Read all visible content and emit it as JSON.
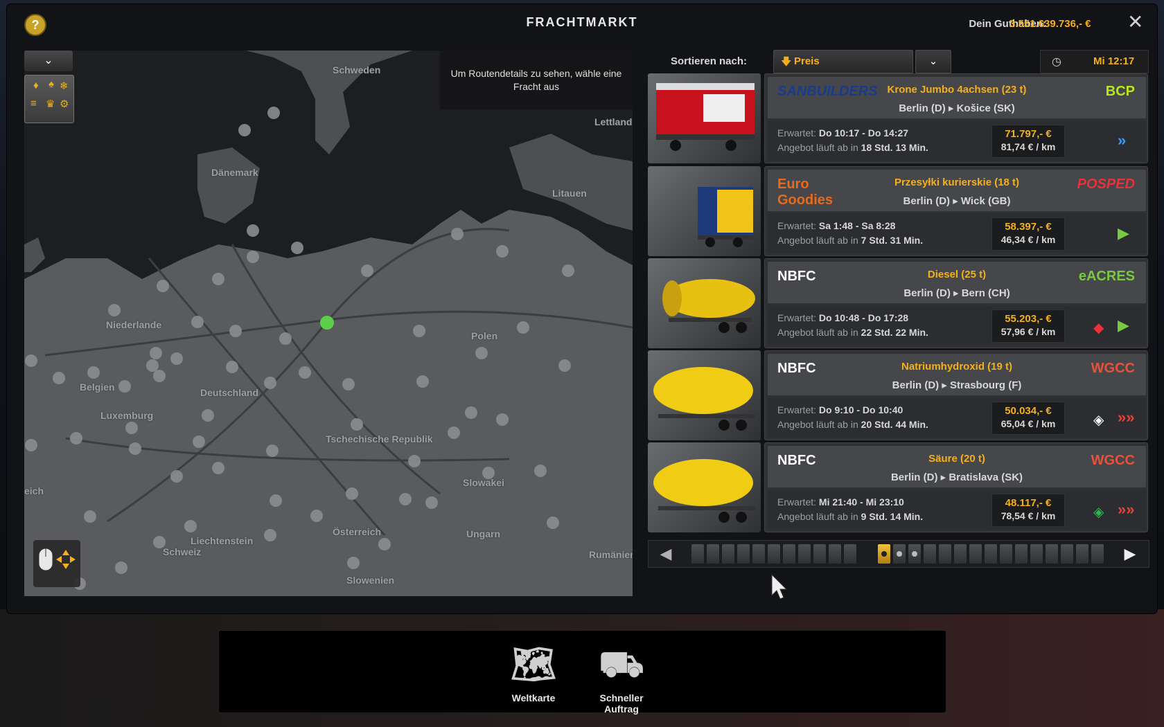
{
  "header": {
    "title": "FRACHTMARKT",
    "help_label": "?",
    "balance_label": "Dein Guthaben:",
    "balance_value": "3.551.639.736,- €",
    "close_label": "✕"
  },
  "map": {
    "hint": "Um Routendetails zu sehen, wähle eine Fracht aus",
    "labels": [
      "Schweden",
      "Dänemark",
      "Lettland",
      "Litauen",
      "Niederlande",
      "Polen",
      "Belgien",
      "Deutschland",
      "Luxemburg",
      "Tschechische Republik",
      "Slowakei",
      "eich",
      "Österreich",
      "Ungarn",
      "Liechtenstein",
      "Schweiz",
      "Rumänien",
      "Slowenien"
    ]
  },
  "toolbar": {
    "sort_label": "Sortieren nach:",
    "sort_value": "Preis",
    "time": "Mi 12:17"
  },
  "cargos": [
    {
      "company": "SANBUILDERS",
      "target_company": "BCP",
      "name": "Krone Jumbo 4achsen (23 t)",
      "from": "Berlin (D)",
      "to": "Košice (SK)",
      "expected_label": "Erwartet:",
      "expected": "Do 10:17 - Do 14:27",
      "offer_label": "Angebot läuft ab in",
      "offer": "18 Std. 13 Min.",
      "price": "71.797,- €",
      "per_km": "81,74 € / km",
      "hazard": "",
      "urgency": "»",
      "urgency_color": "#3b9cff"
    },
    {
      "company": "Euro Goodies",
      "target_company": "POSPED",
      "name": "Przesyłki kurierskie (18 t)",
      "from": "Berlin (D)",
      "to": "Wick (GB)",
      "expected_label": "Erwartet:",
      "expected": "Sa 1:48 - Sa 8:28",
      "offer_label": "Angebot läuft ab in",
      "offer": "7 Std. 31 Min.",
      "price": "58.397,- €",
      "per_km": "46,34 € / km",
      "hazard": "",
      "urgency": "▶",
      "urgency_color": "#7ac943"
    },
    {
      "company": "NBFC",
      "target_company": "eACRES",
      "name": "Diesel (25 t)",
      "from": "Berlin (D)",
      "to": "Bern (CH)",
      "expected_label": "Erwartet:",
      "expected": "Do 10:48 - Do 17:28",
      "offer_label": "Angebot läuft ab in",
      "offer": "22 Std. 22 Min.",
      "price": "55.203,- €",
      "per_km": "57,96 € / km",
      "hazard": "◆",
      "urgency": "▶",
      "urgency_color": "#7ac943"
    },
    {
      "company": "NBFC",
      "target_company": "WGCC",
      "name": "Natriumhydroxid (19 t)",
      "from": "Berlin (D)",
      "to": "Strasbourg (F)",
      "expected_label": "Erwartet:",
      "expected": "Do 9:10 - Do 10:40",
      "offer_label": "Angebot läuft ab in",
      "offer": "20 Std. 44 Min.",
      "price": "50.034,- €",
      "per_km": "65,04 € / km",
      "hazard": "◈",
      "urgency": "»»",
      "urgency_color": "#e8423a"
    },
    {
      "company": "NBFC",
      "target_company": "WGCC",
      "name": "Säure (20 t)",
      "from": "Berlin (D)",
      "to": "Bratislava (SK)",
      "expected_label": "Erwartet:",
      "expected": "Mi 21:40 - Mi 23:10",
      "offer_label": "Angebot läuft ab in",
      "offer": "9 Std. 14 Min.",
      "price": "48.117,- €",
      "per_km": "78,54 € / km",
      "hazard": "◈",
      "urgency": "»»",
      "urgency_color": "#e8423a"
    }
  ],
  "bottom": {
    "worldmap_label": "Weltkarte",
    "quickjob_label_1": "Schneller",
    "quickjob_label_2": "Auftrag"
  }
}
